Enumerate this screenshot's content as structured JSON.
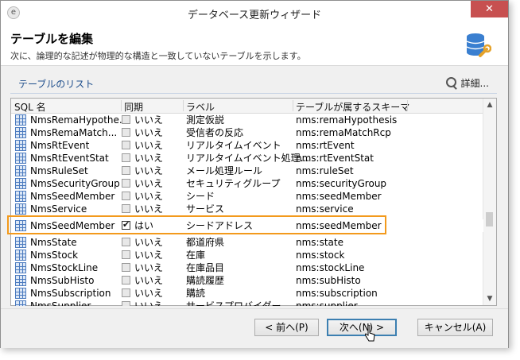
{
  "window": {
    "title": "データベース更新ウィザード",
    "close_glyph": "✕"
  },
  "header": {
    "title": "テーブルを編集",
    "subtitle": "次に、論理的な記述が物理的な構造と一致していないテーブルを示します。"
  },
  "list": {
    "title": "テーブルのリスト",
    "details_label": "詳細..."
  },
  "columns": {
    "sql_name": "SQL 名",
    "sync": "同期",
    "label": "ラベル",
    "schema": "テーブルが属するスキーマ"
  },
  "rows": [
    {
      "name": "NmsRemaHypothe...",
      "sync": "いいえ",
      "checked": false,
      "label": "測定仮説",
      "schema": "nms:remaHypothesis"
    },
    {
      "name": "NmsRemaMatch...",
      "sync": "いいえ",
      "checked": false,
      "label": "受信者の反応",
      "schema": "nms:remaMatchRcp"
    },
    {
      "name": "NmsRtEvent",
      "sync": "いいえ",
      "checked": false,
      "label": "リアルタイムイベント",
      "schema": "nms:rtEvent"
    },
    {
      "name": "NmsRtEventStat",
      "sync": "いいえ",
      "checked": false,
      "label": "リアルタイムイベント処理...",
      "schema": "nms:rtEventStat"
    },
    {
      "name": "NmsRuleSet",
      "sync": "いいえ",
      "checked": false,
      "label": "メール処理ルール",
      "schema": "nms:ruleSet"
    },
    {
      "name": "NmsSecurityGroup",
      "sync": "いいえ",
      "checked": false,
      "label": "セキュリティグループ",
      "schema": "nms:securityGroup"
    },
    {
      "name": "NmsSeedMember",
      "sync": "いいえ",
      "checked": false,
      "label": "シード",
      "schema": "nms:seedMember"
    },
    {
      "name": "NmsService",
      "sync": "いいえ",
      "checked": false,
      "label": "サービス",
      "schema": "nms:service"
    },
    {
      "name": "NmsSeedMember",
      "sync": "はい",
      "checked": true,
      "label": "シードアドレス",
      "schema": "nms:seedMember",
      "highlighted": true
    },
    {
      "name": "NmsState",
      "sync": "いいえ",
      "checked": false,
      "label": "都道府県",
      "schema": "nms:state"
    },
    {
      "name": "NmsStock",
      "sync": "いいえ",
      "checked": false,
      "label": "在庫",
      "schema": "nms:stock"
    },
    {
      "name": "NmsStockLine",
      "sync": "いいえ",
      "checked": false,
      "label": "在庫品目",
      "schema": "nms:stockLine"
    },
    {
      "name": "NmsSubHisto",
      "sync": "いいえ",
      "checked": false,
      "label": "購読履歴",
      "schema": "nms:subHisto"
    },
    {
      "name": "NmsSubscription",
      "sync": "いいえ",
      "checked": false,
      "label": "購読",
      "schema": "nms:subscription"
    },
    {
      "name": "NmsSupplier",
      "sync": "いいえ",
      "checked": false,
      "label": "サービスプロバイダー",
      "schema": "nms:supplier"
    }
  ],
  "buttons": {
    "prev": "< 前へ(P)",
    "next": "次へ(N) >",
    "cancel": "キャンセル(A)"
  },
  "colors": {
    "highlight": "#f39a1c",
    "accent": "#3c7fb1",
    "close": "#c75050"
  }
}
